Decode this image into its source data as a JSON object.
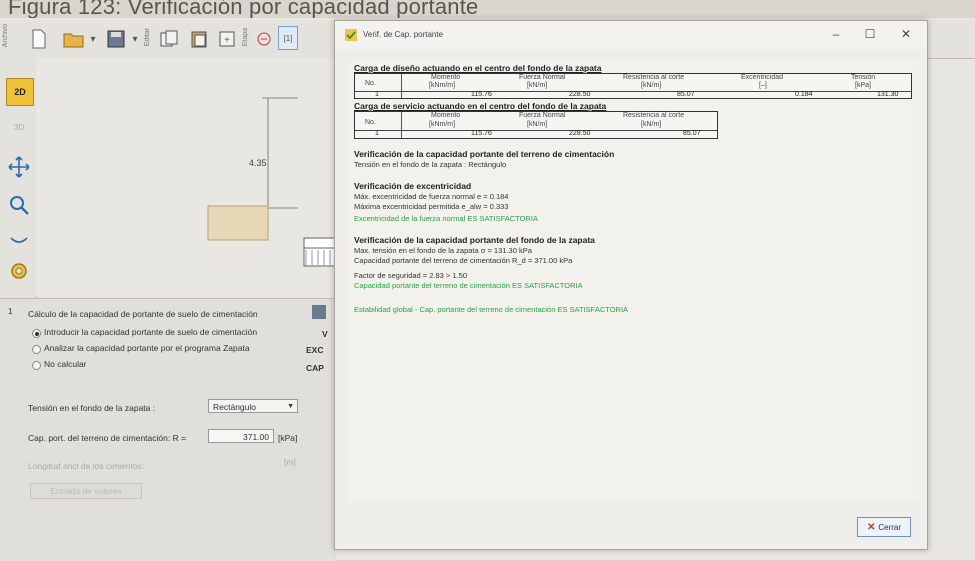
{
  "caption": "Figura 123: Verificación por capacidad portante",
  "toolbar": {
    "editar_label": "Editar",
    "etapa_label": "Etapa",
    "item_label": "[1]"
  },
  "leftbar": {
    "mode_2d": "2D"
  },
  "canvas": {
    "dimension": "4.35"
  },
  "bottom_panel": {
    "heading": "Cálculo de la capacidad de portante de suelo de cimentación",
    "option_1": "Introducir la capacidad portante de suelo de cimentación",
    "option_2": "Analizar la capacidad portante por el programa Zapata",
    "option_3": "No calcular",
    "side_1": "EXC",
    "side_2": "CAP",
    "side_v": "V",
    "tension_label": "Tensión en el fondo de la zapata :",
    "tension_value": "Rectángulo",
    "cap_label": "Cap. port. del terreno de cimentación:  R =",
    "cap_value": "371.00",
    "cap_unit": "[kPa]",
    "longitud_label": "Longitud ancl de los cimientos:",
    "longitud_unit": "[m]",
    "disabled_button": "Entrada de valores"
  },
  "dialog": {
    "title": "Verif. de Cap. portante",
    "close_label": "Cerrar",
    "design_table": {
      "title": "Carga de diseño actuando en el centro del fondo de la zapata",
      "headers": [
        "No.",
        "Momento",
        "Fuerza Normal",
        "Resistencia al corte",
        "Excentricidad",
        "Tensión"
      ],
      "units": [
        "[kNm/m]",
        "[kN/m]",
        "[kN/m]",
        "[–]",
        "[kPa]"
      ],
      "row": [
        "1",
        "115.76",
        "228.50",
        "85.07",
        "0.184",
        "131.30"
      ]
    },
    "service_table": {
      "title": "Carga de servicio actuando en el centro del fondo de la zapata",
      "headers": [
        "No.",
        "Momento",
        "Fuerza Normal",
        "Resistencia al corte"
      ],
      "units": [
        "[kNm/m]",
        "[kN/m]",
        "[kN/m]"
      ],
      "row": [
        "1",
        "115.76",
        "228.50",
        "85.07"
      ]
    },
    "verif_title": "Verificación de la capacidad portante del terreno de cimentación",
    "verif_sub": "Tensión en el fondo de la zapata : Rectángulo",
    "exc_title": "Verificación de excentricidad",
    "exc_line1": "Máx. excentricidad de fuerza normal  e     = 0.184",
    "exc_line2": "Máxima excentricidad permitida       e_alw = 0.333",
    "exc_ok": "Excentricidad de la fuerza normal ES SATISFACTORIA",
    "fondo_title": "Verificación de la capacidad portante del fondo de la zapata",
    "fondo_line1": "Max. tensión en el fondo de la zapata                   σ   = 131.30 kPa",
    "fondo_line2": "Capacidad portante del terreno de cimentación  R_d = 371.00 kPa",
    "fondo_line3": "Factor de seguridad = 2.83 > 1.50",
    "fondo_ok": "Capacidad portante del terreno de cimentación ES SATISFACTORIA",
    "global_ok": "Estabilidad global - Cap. portante del terreno de cimentación ES SATISFACTORIA"
  }
}
